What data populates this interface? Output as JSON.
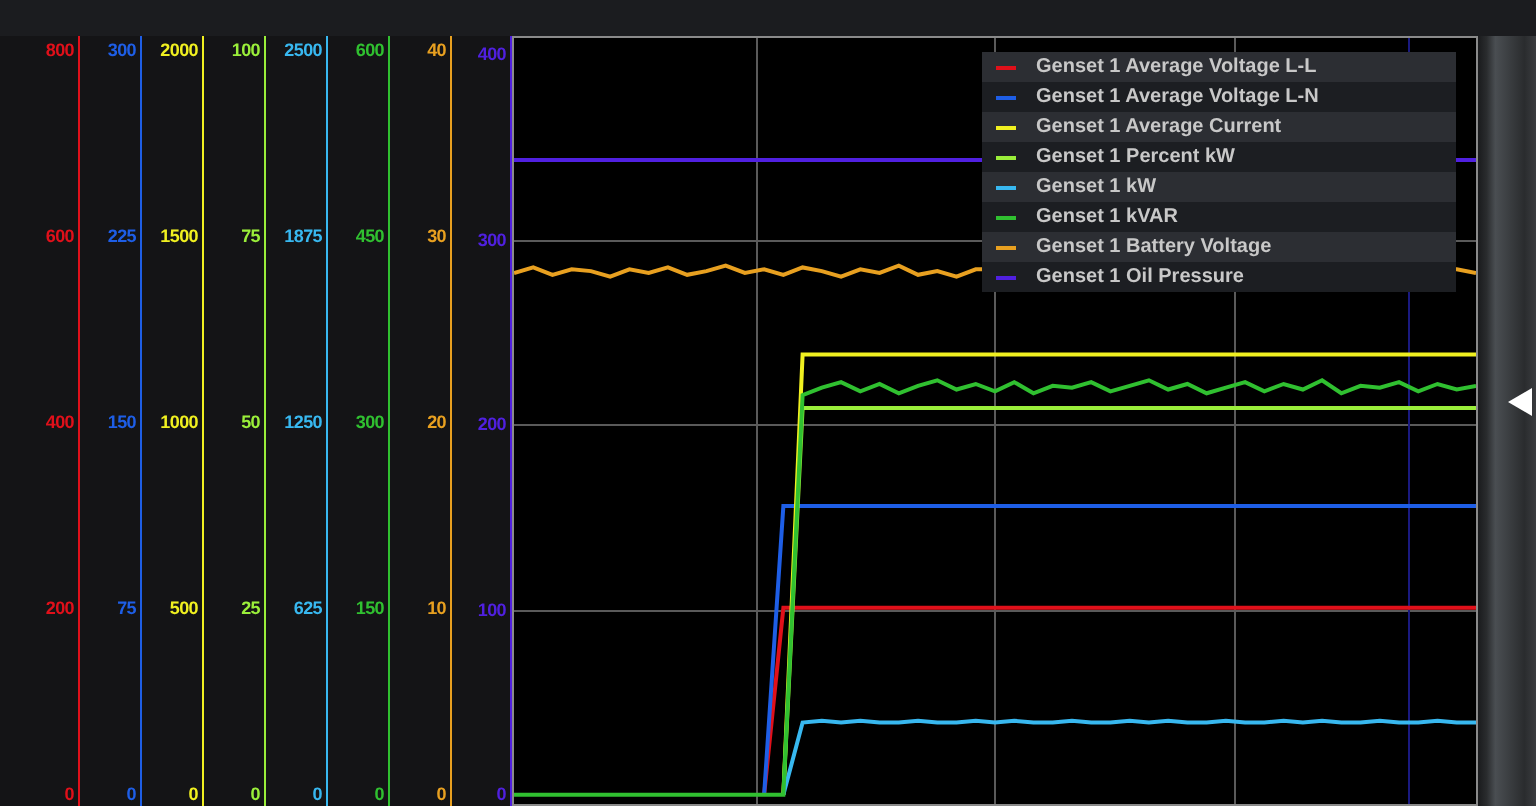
{
  "axes": [
    {
      "color": "#e0101a",
      "ticks": [
        "800",
        "600",
        "400",
        "200",
        "0"
      ]
    },
    {
      "color": "#1e5ee6",
      "ticks": [
        "300",
        "225",
        "150",
        "75",
        "0"
      ]
    },
    {
      "color": "#f0f020",
      "ticks": [
        "2000",
        "1500",
        "1000",
        "500",
        "0"
      ]
    },
    {
      "color": "#9aee3a",
      "ticks": [
        "100",
        "75",
        "50",
        "25",
        "0"
      ]
    },
    {
      "color": "#38b8f0",
      "ticks": [
        "2500",
        "1875",
        "1250",
        "625",
        "0"
      ]
    },
    {
      "color": "#30c030",
      "ticks": [
        "600",
        "450",
        "300",
        "150",
        "0"
      ]
    },
    {
      "color": "#e8a020",
      "ticks": [
        "40",
        "30",
        "20",
        "10",
        "0"
      ]
    },
    {
      "color": "#5020e0"
    }
  ],
  "plot": {
    "chart_data": {
      "type": "line",
      "ylim": [
        -5,
        409
      ],
      "yticks": [
        {
          "value": 0,
          "label": "0"
        },
        {
          "value": 100,
          "label": "100"
        },
        {
          "value": 200,
          "label": "200"
        },
        {
          "value": 300,
          "label": "300"
        },
        {
          "value": 400,
          "label": "400"
        }
      ],
      "grid": true,
      "legend": "top-right",
      "categories": [
        null,
        null,
        null,
        null,
        null,
        null,
        null,
        null,
        null,
        null,
        null,
        null,
        null,
        null,
        null,
        null,
        null,
        null,
        null,
        null,
        null,
        null,
        null,
        null,
        null,
        null,
        null,
        null,
        null,
        null,
        null,
        null,
        null,
        null,
        null,
        null,
        null,
        null,
        null,
        null,
        null,
        null,
        null,
        null,
        null,
        null,
        null,
        null,
        null,
        null,
        null
      ],
      "series": [
        {
          "name": "Genset 1 Average Voltage L-L",
          "color": "#e0101a",
          "values": [
            null,
            null,
            null,
            null,
            null,
            null,
            null,
            null,
            null,
            null,
            null,
            null,
            null,
            0,
            101,
            101,
            101,
            101,
            101,
            101,
            101,
            101,
            101,
            101,
            101,
            101,
            101,
            101,
            101,
            101,
            101,
            101,
            101,
            101,
            101,
            101,
            101,
            101,
            101,
            101,
            101,
            101,
            101,
            101,
            101,
            101,
            101,
            101,
            101,
            101,
            101
          ]
        },
        {
          "name": "Genset 1 Average Voltage L-N",
          "color": "#1e5ee6",
          "values": [
            null,
            null,
            null,
            null,
            null,
            null,
            null,
            null,
            null,
            null,
            null,
            null,
            null,
            0,
            156,
            156,
            156,
            156,
            156,
            156,
            156,
            156,
            156,
            156,
            156,
            156,
            156,
            156,
            156,
            156,
            156,
            156,
            156,
            156,
            156,
            156,
            156,
            156,
            156,
            156,
            156,
            156,
            156,
            156,
            156,
            156,
            156,
            156,
            156,
            156,
            156
          ]
        },
        {
          "name": "Genset 1 Average Current",
          "color": "#f0f020",
          "values": [
            null,
            null,
            null,
            null,
            null,
            null,
            null,
            null,
            null,
            null,
            null,
            null,
            null,
            null,
            0,
            238,
            238,
            238,
            238,
            238,
            238,
            238,
            238,
            238,
            238,
            238,
            238,
            238,
            238,
            238,
            238,
            238,
            238,
            238,
            238,
            238,
            238,
            238,
            238,
            238,
            238,
            238,
            238,
            238,
            238,
            238,
            238,
            238,
            238,
            238,
            238
          ]
        },
        {
          "name": "Genset 1 Percent kW",
          "color": "#9aee3a",
          "values": [
            null,
            null,
            null,
            null,
            null,
            null,
            null,
            null,
            null,
            null,
            null,
            null,
            null,
            null,
            0,
            209,
            209,
            209,
            209,
            209,
            209,
            209,
            209,
            209,
            209,
            209,
            209,
            209,
            209,
            209,
            209,
            209,
            209,
            209,
            209,
            209,
            209,
            209,
            209,
            209,
            209,
            209,
            209,
            209,
            209,
            209,
            209,
            209,
            209,
            209,
            209
          ]
        },
        {
          "name": "Genset 1 kW",
          "color": "#38b8f0",
          "values": [
            null,
            null,
            null,
            null,
            null,
            null,
            null,
            null,
            null,
            null,
            null,
            null,
            null,
            null,
            0,
            39,
            40,
            39,
            40,
            39,
            39,
            40,
            39,
            39,
            40,
            39,
            40,
            39,
            39,
            40,
            39,
            39,
            40,
            39,
            40,
            39,
            39,
            40,
            39,
            39,
            40,
            39,
            40,
            39,
            39,
            40,
            39,
            39,
            40,
            39,
            39
          ]
        },
        {
          "name": "Genset 1 kVAR",
          "color": "#30c030",
          "values": [
            0,
            0,
            0,
            0,
            0,
            0,
            0,
            0,
            0,
            0,
            0,
            0,
            0,
            0,
            0,
            216,
            220,
            223,
            218,
            222,
            217,
            221,
            224,
            219,
            222,
            218,
            223,
            217,
            221,
            220,
            223,
            218,
            221,
            224,
            219,
            222,
            217,
            220,
            223,
            218,
            222,
            219,
            224,
            217,
            221,
            220,
            223,
            218,
            222,
            219,
            221
          ]
        },
        {
          "name": "Genset 1 Battery Voltage",
          "color": "#e8a020",
          "values": [
            282,
            285,
            281,
            284,
            283,
            280,
            284,
            282,
            285,
            281,
            283,
            286,
            282,
            284,
            281,
            285,
            283,
            280,
            284,
            282,
            286,
            281,
            283,
            280,
            284,
            null,
            null,
            null,
            null,
            null,
            null,
            null,
            null,
            null,
            null,
            null,
            null,
            null,
            null,
            null,
            null,
            null,
            null,
            null,
            null,
            null,
            null,
            null,
            null,
            284,
            282
          ]
        },
        {
          "name": "Genset 1 Oil Pressure",
          "color": "#5020e0",
          "values": [
            343,
            343,
            343,
            343,
            343,
            343,
            343,
            343,
            343,
            343,
            343,
            343,
            343,
            343,
            343,
            343,
            343,
            343,
            343,
            343,
            343,
            343,
            343,
            343,
            343,
            null,
            null,
            null,
            null,
            null,
            null,
            null,
            null,
            null,
            null,
            null,
            null,
            null,
            null,
            null,
            null,
            null,
            null,
            null,
            null,
            null,
            null,
            null,
            null,
            343,
            343
          ]
        }
      ]
    }
  }
}
